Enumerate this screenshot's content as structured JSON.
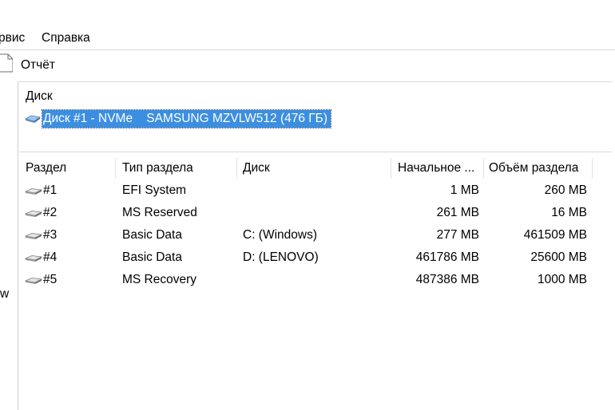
{
  "menubar": {
    "items": [
      {
        "label": "рвис"
      },
      {
        "label": "Справка"
      }
    ]
  },
  "toolbar": {
    "report_label": "Отчёт",
    "report_icon": "document-icon"
  },
  "left_panel": {
    "truncated_text": "w"
  },
  "disk_section": {
    "label": "Диск",
    "selected_disk": "Диск #1 - NVMe    SAMSUNG MZVLW512 (476 ГБ)",
    "icon": "drive-icon",
    "selection_color": "#3c8fe0"
  },
  "partition_table": {
    "columns": [
      "Раздел",
      "Тип раздела",
      "Диск",
      "Начальное ...",
      "Объём раздела"
    ],
    "rows": [
      {
        "partition": "#1",
        "type": "EFI System",
        "disk": "",
        "start": "1 MB",
        "size": "260 MB"
      },
      {
        "partition": "#2",
        "type": "MS Reserved",
        "disk": "",
        "start": "261 MB",
        "size": "16 MB"
      },
      {
        "partition": "#3",
        "type": "Basic Data",
        "disk": "C: (Windows)",
        "start": "277 MB",
        "size": "461509 MB"
      },
      {
        "partition": "#4",
        "type": "Basic Data",
        "disk": "D: (LENOVO)",
        "start": "461786 MB",
        "size": "25600 MB"
      },
      {
        "partition": "#5",
        "type": "MS Recovery",
        "disk": "",
        "start": "487386 MB",
        "size": "1000 MB"
      }
    ]
  }
}
